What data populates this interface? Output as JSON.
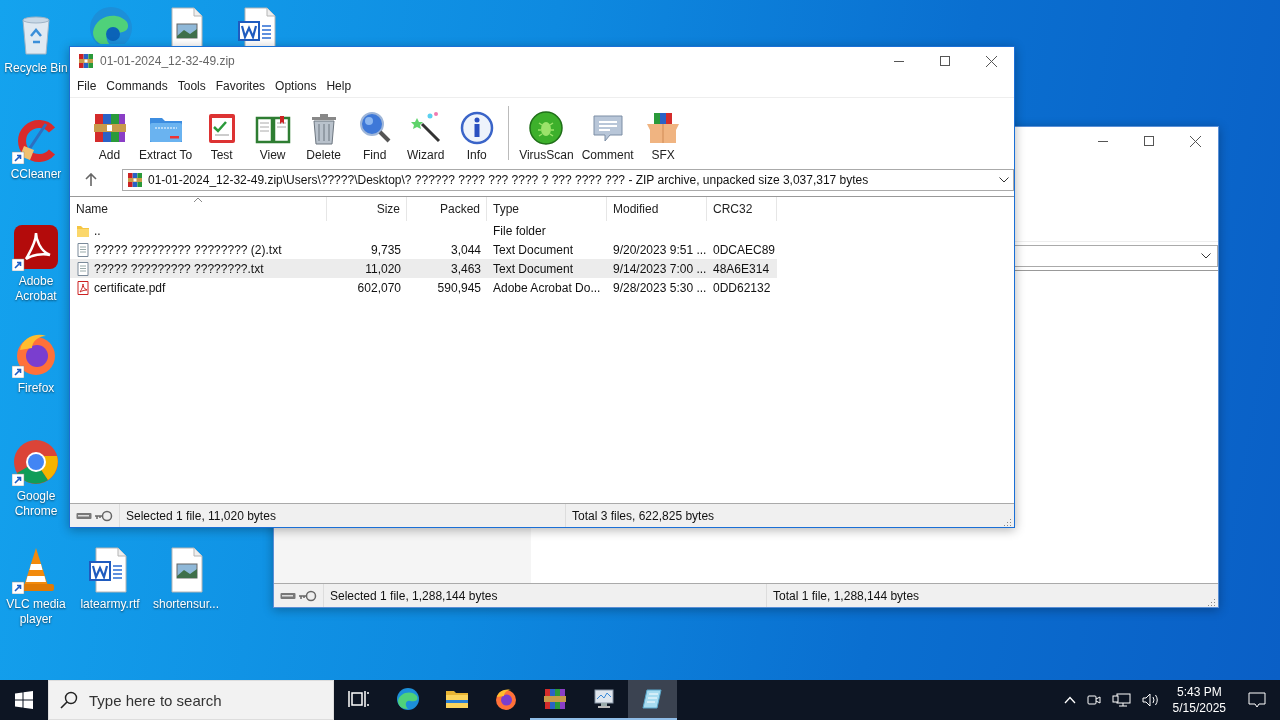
{
  "desktop_icons": [
    {
      "kind": "recycle",
      "label": "Recycle Bin",
      "shortcut": false
    },
    {
      "kind": "edge",
      "shortcut": false
    },
    {
      "kind": "image",
      "shortcut": false
    },
    {
      "kind": "word",
      "shortcut": false
    },
    {
      "kind": "ccleaner",
      "label": "CCleaner",
      "shortcut": true
    },
    {
      "kind": "acrobat",
      "label": "Adobe Acrobat",
      "shortcut": true
    },
    {
      "kind": "firefox",
      "label": "Firefox",
      "shortcut": true
    },
    {
      "kind": "chrome",
      "label": "Google Chrome",
      "shortcut": true
    },
    {
      "kind": "vlc",
      "label": "VLC media player",
      "shortcut": true
    },
    {
      "kind": "word",
      "label": "latearmy.rtf",
      "shortcut": false
    },
    {
      "kind": "image",
      "label": "shortensur...",
      "shortcut": false
    }
  ],
  "back_window": {
    "status": [
      "Selected 1 file, 1,288,144 bytes",
      "Total 1 file, 1,288,144 bytes"
    ]
  },
  "window": {
    "title": "01-01-2024_12-32-49.zip",
    "menu": [
      "File",
      "Commands",
      "Tools",
      "Favorites",
      "Options",
      "Help"
    ],
    "toolbar": [
      {
        "kind": "add",
        "label": "Add"
      },
      {
        "kind": "extract",
        "label": "Extract To"
      },
      {
        "kind": "test",
        "label": "Test"
      },
      {
        "kind": "view",
        "label": "View"
      },
      {
        "kind": "delete",
        "label": "Delete"
      },
      {
        "kind": "find",
        "label": "Find"
      },
      {
        "kind": "wizard",
        "label": "Wizard"
      },
      {
        "kind": "info",
        "label": "Info"
      },
      {
        "kind": "separator"
      },
      {
        "kind": "virusscan",
        "label": "VirusScan"
      },
      {
        "kind": "comment",
        "label": "Comment"
      },
      {
        "kind": "sfx",
        "label": "SFX"
      }
    ],
    "address": "01-01-2024_12-32-49.zip\\Users\\?????\\Desktop\\? ?????? ???? ??? ???? ? ??? ???? ??? - ZIP archive, unpacked size 3,037,317 bytes",
    "columns": [
      {
        "label": "Name",
        "sorted": true
      },
      {
        "label": "Size",
        "sorted": false
      },
      {
        "label": "Packed",
        "sorted": false
      },
      {
        "label": "Type",
        "sorted": false
      },
      {
        "label": "Modified",
        "sorted": false
      },
      {
        "label": "CRC32",
        "sorted": false
      }
    ],
    "rows": [
      {
        "kind": "folder",
        "name": "..",
        "type": "File folder",
        "selected": false
      },
      {
        "kind": "text",
        "name": "????? ????????? ???????? (2).txt",
        "size": "9,735",
        "packed": "3,044",
        "type": "Text Document",
        "modified": "9/20/2023 9:51 ...",
        "crc32": "0DCAEC89",
        "selected": false
      },
      {
        "kind": "text",
        "name": "????? ????????? ????????.txt",
        "size": "11,020",
        "packed": "3,463",
        "type": "Text Document",
        "modified": "9/14/2023 7:00 ...",
        "crc32": "48A6E314",
        "selected": true
      },
      {
        "kind": "pdf",
        "name": "certificate.pdf",
        "size": "602,070",
        "packed": "590,945",
        "type": "Adobe Acrobat Do...",
        "modified": "9/28/2023 5:30 ...",
        "crc32": "0DD62132",
        "selected": false
      }
    ],
    "status": [
      "Selected 1 file, 11,020 bytes",
      "Total 3 files, 622,825 bytes"
    ]
  },
  "taskbar": {
    "search": {
      "placeholder": "Type here to search"
    },
    "apps": [
      {
        "kind": "taskview",
        "running": false,
        "active": false
      },
      {
        "kind": "edge",
        "running": false,
        "active": false
      },
      {
        "kind": "explorer",
        "running": false,
        "active": false
      },
      {
        "kind": "firefox",
        "running": false,
        "active": false
      },
      {
        "kind": "winrar",
        "running": true,
        "active": false
      },
      {
        "kind": "monitor",
        "running": true,
        "active": false
      },
      {
        "kind": "notepad",
        "running": true,
        "active": true
      }
    ],
    "time": "5:43 PM",
    "date": "5/15/2025"
  }
}
